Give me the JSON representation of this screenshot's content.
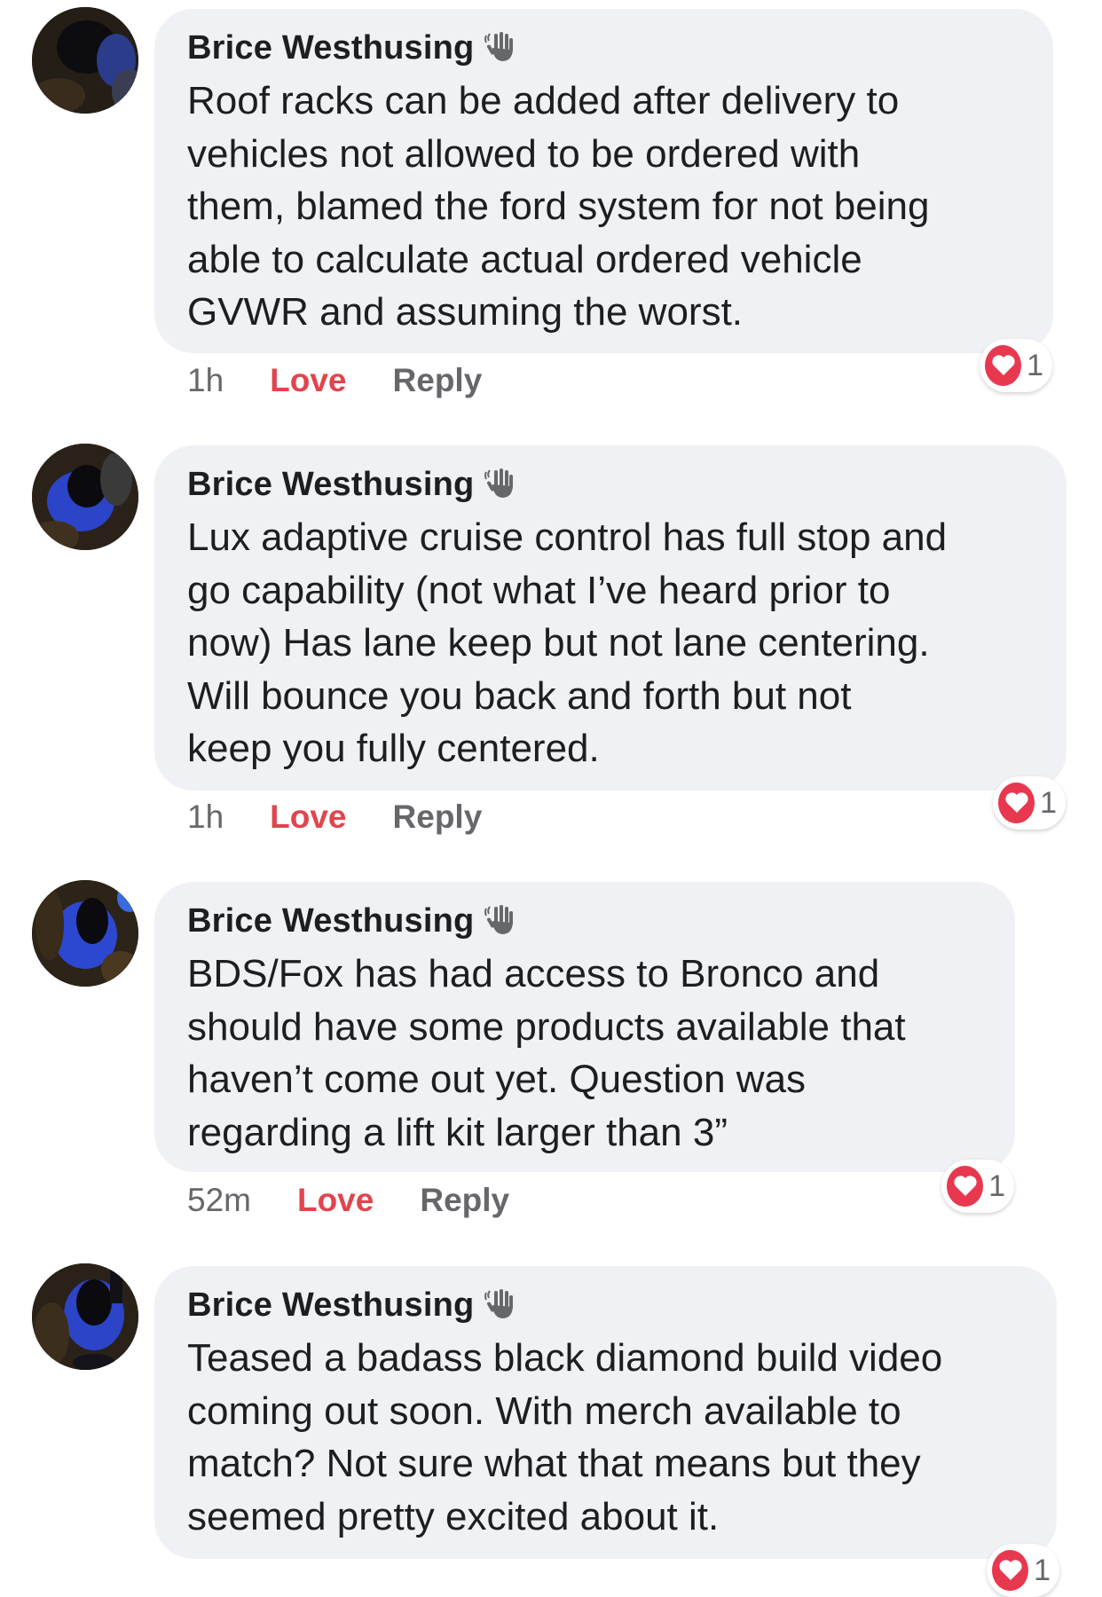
{
  "comments": [
    {
      "author": "Brice Westhusing",
      "text": "Roof racks can be added after delivery to\nvehicles not allowed to be ordered with\nthem, blamed the ford system for not being\nable to calculate actual ordered vehicle\nGVWR and assuming the worst.",
      "time": "1h",
      "love_label": "Love",
      "reply_label": "Reply",
      "reaction_count": "1",
      "badge_icon": "waving-hand-icon",
      "reaction_icon": "heart-icon"
    },
    {
      "author": "Brice Westhusing",
      "text": "Lux adaptive cruise control has full stop and\ngo capability (not what I’ve heard prior to\nnow) Has lane keep but not lane centering.\nWill bounce you back and forth but not\nkeep you fully centered.",
      "time": "1h",
      "love_label": "Love",
      "reply_label": "Reply",
      "reaction_count": "1",
      "badge_icon": "waving-hand-icon",
      "reaction_icon": "heart-icon"
    },
    {
      "author": "Brice Westhusing",
      "text": "BDS/Fox has had access to Bronco and\nshould have some products available that\nhaven’t come out yet. Question was\nregarding a lift kit larger than 3”",
      "time": "52m",
      "love_label": "Love",
      "reply_label": "Reply",
      "reaction_count": "1",
      "badge_icon": "waving-hand-icon",
      "reaction_icon": "heart-icon"
    },
    {
      "author": "Brice Westhusing",
      "text": "Teased a badass black diamond build video\ncoming out soon. With merch available to\nmatch? Not sure what that means but they\nseemed pretty excited about it.",
      "time": "",
      "love_label": "",
      "reply_label": "",
      "reaction_count": "1",
      "badge_icon": "waving-hand-icon",
      "reaction_icon": "heart-icon"
    }
  ],
  "colors": {
    "bubble_bg": "#f0f1f4",
    "love": "#e0454e",
    "heart": "#e8384f",
    "meta_text": "#65676b",
    "body_text": "#1c1e21"
  }
}
